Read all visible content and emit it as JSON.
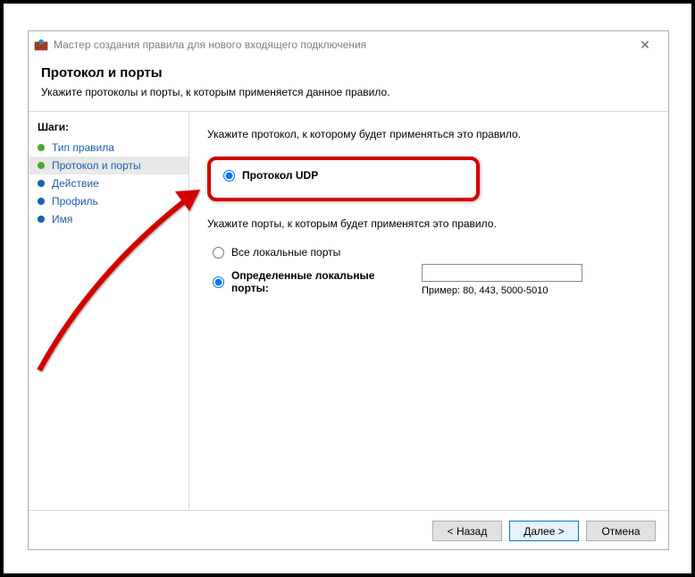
{
  "window": {
    "title": "Мастер создания правила для нового входящего подключения"
  },
  "header": {
    "title": "Протокол и порты",
    "subtitle": "Укажите протоколы и порты, к которым применяется данное правило."
  },
  "sidebar": {
    "title": "Шаги:",
    "items": [
      {
        "label": "Тип правила"
      },
      {
        "label": "Протокол и порты"
      },
      {
        "label": "Действие"
      },
      {
        "label": "Профиль"
      },
      {
        "label": "Имя"
      }
    ]
  },
  "content": {
    "protocol_prompt": "Укажите протокол, к которому будет применяться это правило.",
    "protocol_udp": "Протокол UDP",
    "ports_prompt": "Укажите порты, к которым будет применятся это правило.",
    "all_ports": "Все локальные порты",
    "specific_ports": "Определенные локальные порты:",
    "port_value": "",
    "port_example": "Пример: 80, 443, 5000-5010"
  },
  "footer": {
    "back": "< Назад",
    "next": "Далее >",
    "cancel": "Отмена"
  }
}
